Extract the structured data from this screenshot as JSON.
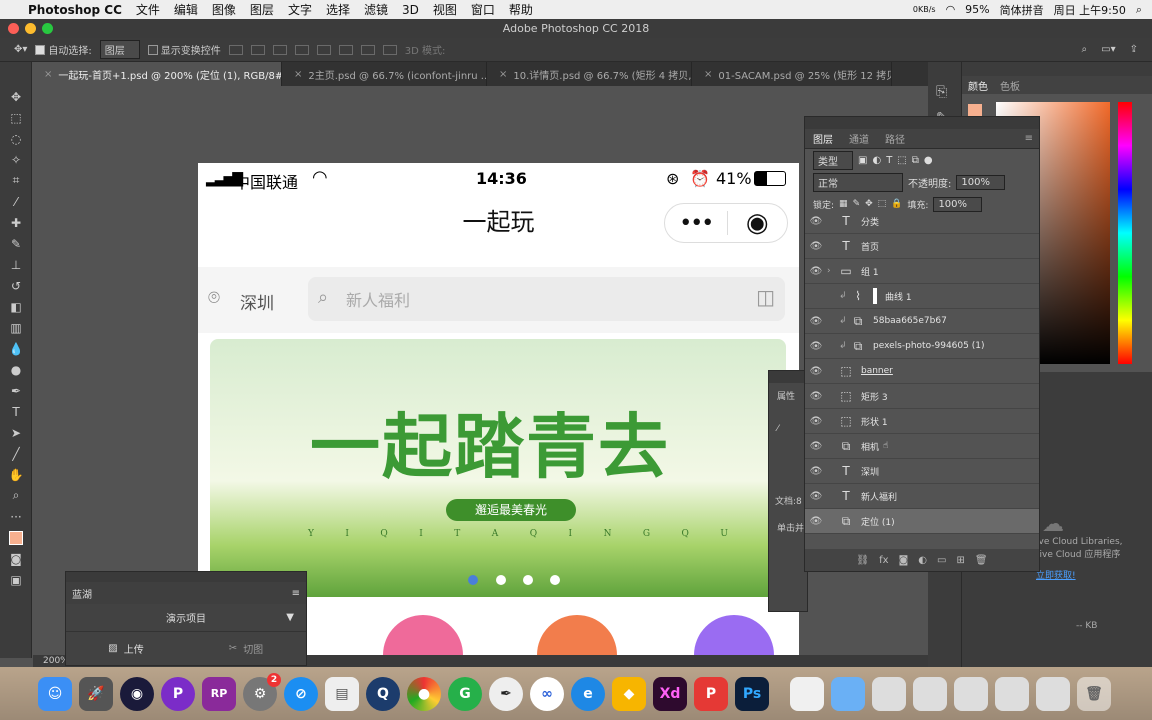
{
  "menubar": {
    "app": "Photoshop CC",
    "items": [
      "文件",
      "编辑",
      "图像",
      "图层",
      "文字",
      "选择",
      "滤镜",
      "3D",
      "视图",
      "窗口",
      "帮助"
    ],
    "net": "0KB/s",
    "battery": "95%",
    "ime": "简体拼音",
    "clock": "周日 上午9:50"
  },
  "window": {
    "title": "Adobe Photoshop CC 2018"
  },
  "options": {
    "auto_select_label": "自动选择:",
    "auto_select_value": "图层",
    "transform_label": "显示变换控件",
    "mode_label": "3D 模式:"
  },
  "tabs": [
    {
      "label": "一起玩-首页+1.psd @ 200% (定位 (1), RGB/8#) *",
      "active": true
    },
    {
      "label": "2主页.psd @ 66.7% (iconfont-jinru ...",
      "active": false
    },
    {
      "label": "10.详情页.psd @ 66.7% (矩形 4 拷贝, ...",
      "active": false
    },
    {
      "label": "01-SACAM.psd @ 25% (矩形 12 拷贝,...",
      "active": false
    }
  ],
  "status": {
    "zoom": "200%"
  },
  "phone": {
    "carrier": "中国联通",
    "time": "14:36",
    "battery": "41%",
    "title": "一起玩",
    "city": "深圳",
    "search_placeholder": "新人福利",
    "banner_title": "一起踏青去",
    "banner_pill": "邂逅最美春光",
    "banner_pinyin": [
      "Y",
      "I",
      "Q",
      "I",
      "T",
      "A",
      "Q",
      "I",
      "N",
      "G",
      "Q",
      "U"
    ]
  },
  "layers_panel": {
    "tabs": [
      "图层",
      "通道",
      "路径"
    ],
    "filter": "类型",
    "blend_mode": "正常",
    "opacity_label": "不透明度:",
    "opacity": "100%",
    "lock_label": "锁定:",
    "fill_label": "填充:",
    "fill": "100%",
    "layers": [
      {
        "name": "分类",
        "type": "text",
        "visible": true
      },
      {
        "name": "首页",
        "type": "text",
        "visible": true
      },
      {
        "name": "组 1",
        "type": "group",
        "visible": true
      },
      {
        "name": "曲线 1",
        "type": "adjust",
        "visible": false
      },
      {
        "name": "58baa665e7b67",
        "type": "smart",
        "visible": true
      },
      {
        "name": "pexels-photo-994605 (1)",
        "type": "smart",
        "visible": true
      },
      {
        "name": "banner",
        "type": "shape",
        "visible": true
      },
      {
        "name": "矩形 3",
        "type": "shape",
        "visible": true
      },
      {
        "name": "形状 1",
        "type": "shape",
        "visible": true
      },
      {
        "name": "相机",
        "type": "smart",
        "visible": true
      },
      {
        "name": "深圳",
        "type": "text",
        "visible": true
      },
      {
        "name": "新人福利",
        "type": "text",
        "visible": true
      },
      {
        "name": "定位 (1)",
        "type": "smart",
        "visible": true
      }
    ]
  },
  "properties": {
    "title": "属性",
    "doc_label": "文档:8",
    "hint": "单击并"
  },
  "color_panel": {
    "tabs": [
      "颜色",
      "色板"
    ]
  },
  "libraries": {
    "text1": "ive Cloud Libraries,",
    "text2": "tive Cloud 应用程序",
    "link": "立即获取!",
    "size": "-- KB"
  },
  "lanhu": {
    "title": "蓝湖",
    "project": "演示项目",
    "upload": "上传",
    "slice": "切图"
  },
  "dock": [
    "Finder",
    "Launchpad",
    "Cinema4D",
    "Pixelmator",
    "Axure RP",
    "系统偏好设置",
    "Safari",
    "备忘录",
    "QuickTime",
    "Chrome",
    "Green",
    "Pen",
    "Baidu",
    "Edge",
    "Sketch",
    "XD",
    "Axure",
    "Photoshop"
  ],
  "dock_badge": "2"
}
